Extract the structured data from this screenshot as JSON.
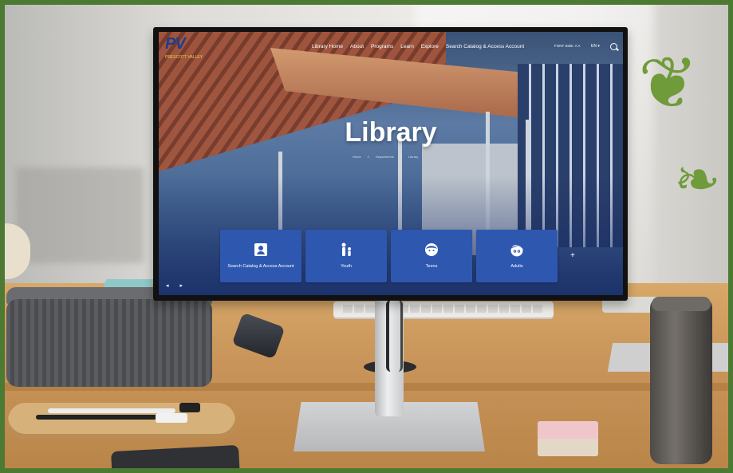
{
  "screen": {
    "nav": {
      "logo_text": "PV",
      "logo_sub": "PRESCOTT VALLEY",
      "links": [
        "Library Home",
        "About",
        "Programs",
        "Learn",
        "Explore",
        "Search Catalog & Access Account"
      ],
      "utility_text": "FONT SIZE: A A",
      "lang": "EN ▾"
    },
    "hero_title": "Library",
    "breadcrumbs": [
      "Home",
      "//",
      "Departments",
      "//",
      "Library"
    ],
    "cards": [
      {
        "label": "Search Catalog & Access Account",
        "icon": "account-icon"
      },
      {
        "label": "Youth",
        "icon": "parent-child-icon"
      },
      {
        "label": "Teens",
        "icon": "teen-face-icon"
      },
      {
        "label": "Adults",
        "icon": "adult-face-icon"
      }
    ],
    "carousel_next": "+",
    "carousel_prev": "◂ ▸"
  },
  "colors": {
    "card_blue": "#2e57b0",
    "nav_text": "#ffffff",
    "logo_blue": "#1d3c8f",
    "logo_gold": "#f2d24b",
    "frame_green": "#4c7a33"
  }
}
